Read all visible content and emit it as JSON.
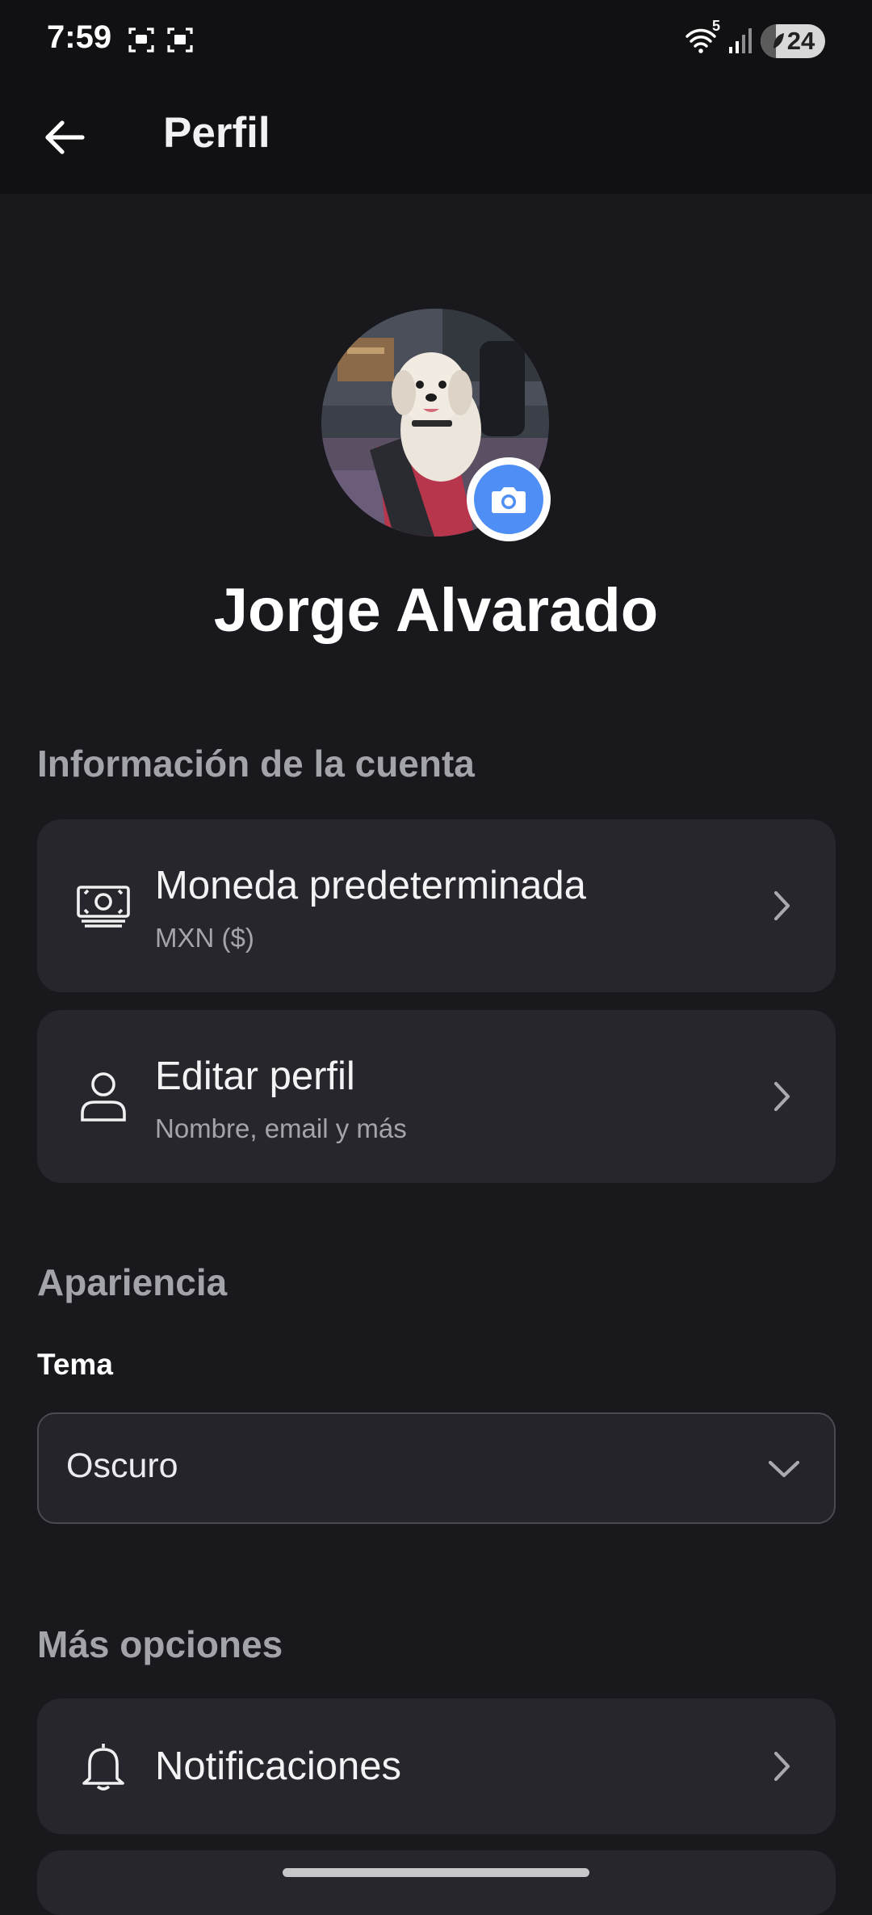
{
  "status_bar": {
    "time": "7:59",
    "battery_level": "24",
    "battery_fraction": 0.24,
    "icons": [
      "screenshot-icon",
      "screen-record-icon",
      "wifi-icon",
      "signal-icon",
      "battery-icon"
    ],
    "wifi_badge": "5"
  },
  "app_bar": {
    "title": "Perfil",
    "back_icon": "arrow-left-icon"
  },
  "profile": {
    "name": "Jorge Alvarado",
    "camera_icon": "camera-icon"
  },
  "account_section": {
    "heading": "Información de la cuenta",
    "items": [
      {
        "icon": "money-icon",
        "title": "Moneda predeterminada",
        "subtitle": "MXN ($)"
      },
      {
        "icon": "person-icon",
        "title": "Editar perfil",
        "subtitle": "Nombre, email y más"
      }
    ]
  },
  "appearance_section": {
    "heading": "Apariencia",
    "theme_label": "Tema",
    "theme_value": "Oscuro"
  },
  "more_section": {
    "heading": "Más opciones",
    "items": [
      {
        "icon": "bell-icon",
        "title": "Notificaciones"
      }
    ]
  },
  "colors": {
    "background": "#18181d",
    "app_bar": "#111114",
    "card": "#26262c",
    "accent": "#4f8ff5",
    "muted_text": "#a3a3aa"
  }
}
